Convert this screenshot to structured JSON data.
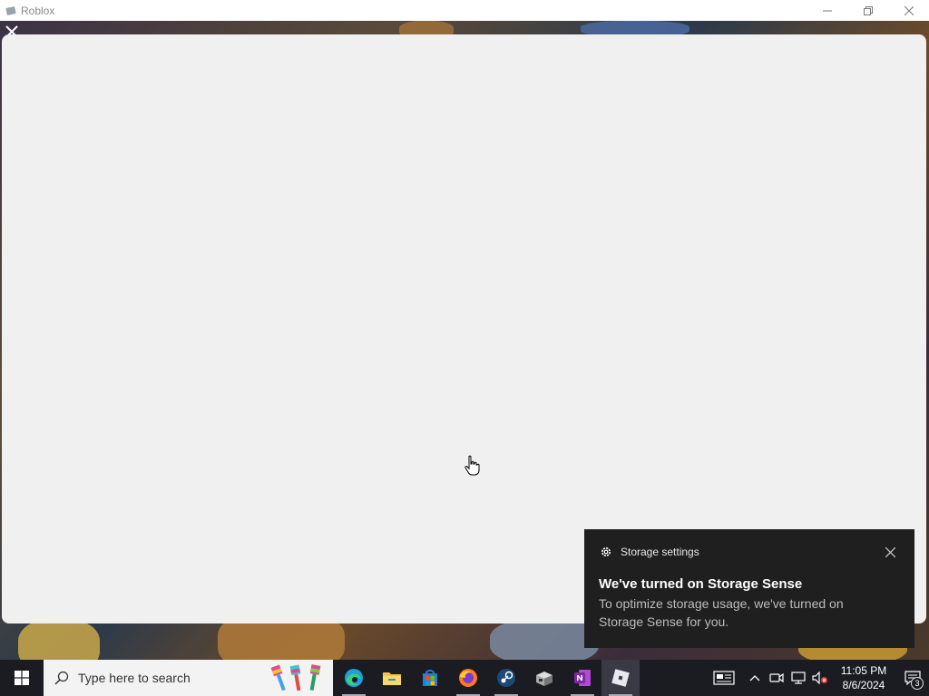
{
  "window": {
    "title": "Roblox",
    "controls": [
      "minimize-icon",
      "restore-icon",
      "close-icon"
    ]
  },
  "toast": {
    "app": "Storage settings",
    "title": "We've turned on Storage Sense",
    "body": "To optimize storage usage, we've turned on Storage Sense for you."
  },
  "taskbar": {
    "search_placeholder": "Type here to search",
    "pinned": [
      {
        "icon": "edge-icon"
      },
      {
        "icon": "file-explorer-icon"
      },
      {
        "icon": "microsoft-store-icon"
      },
      {
        "icon": "firefox-icon"
      },
      {
        "icon": "steam-icon"
      },
      {
        "icon": "app-box-icon"
      },
      {
        "icon": "onenote-icon"
      },
      {
        "icon": "roblox-icon"
      }
    ],
    "clock_time": "11:05 PM",
    "clock_date": "8/6/2024",
    "notification_count": "3"
  },
  "colors": {
    "dialog": "#f0f0f0",
    "toast_bg": "#1f1f1f",
    "taskbar_bg": "#1b1b22"
  }
}
